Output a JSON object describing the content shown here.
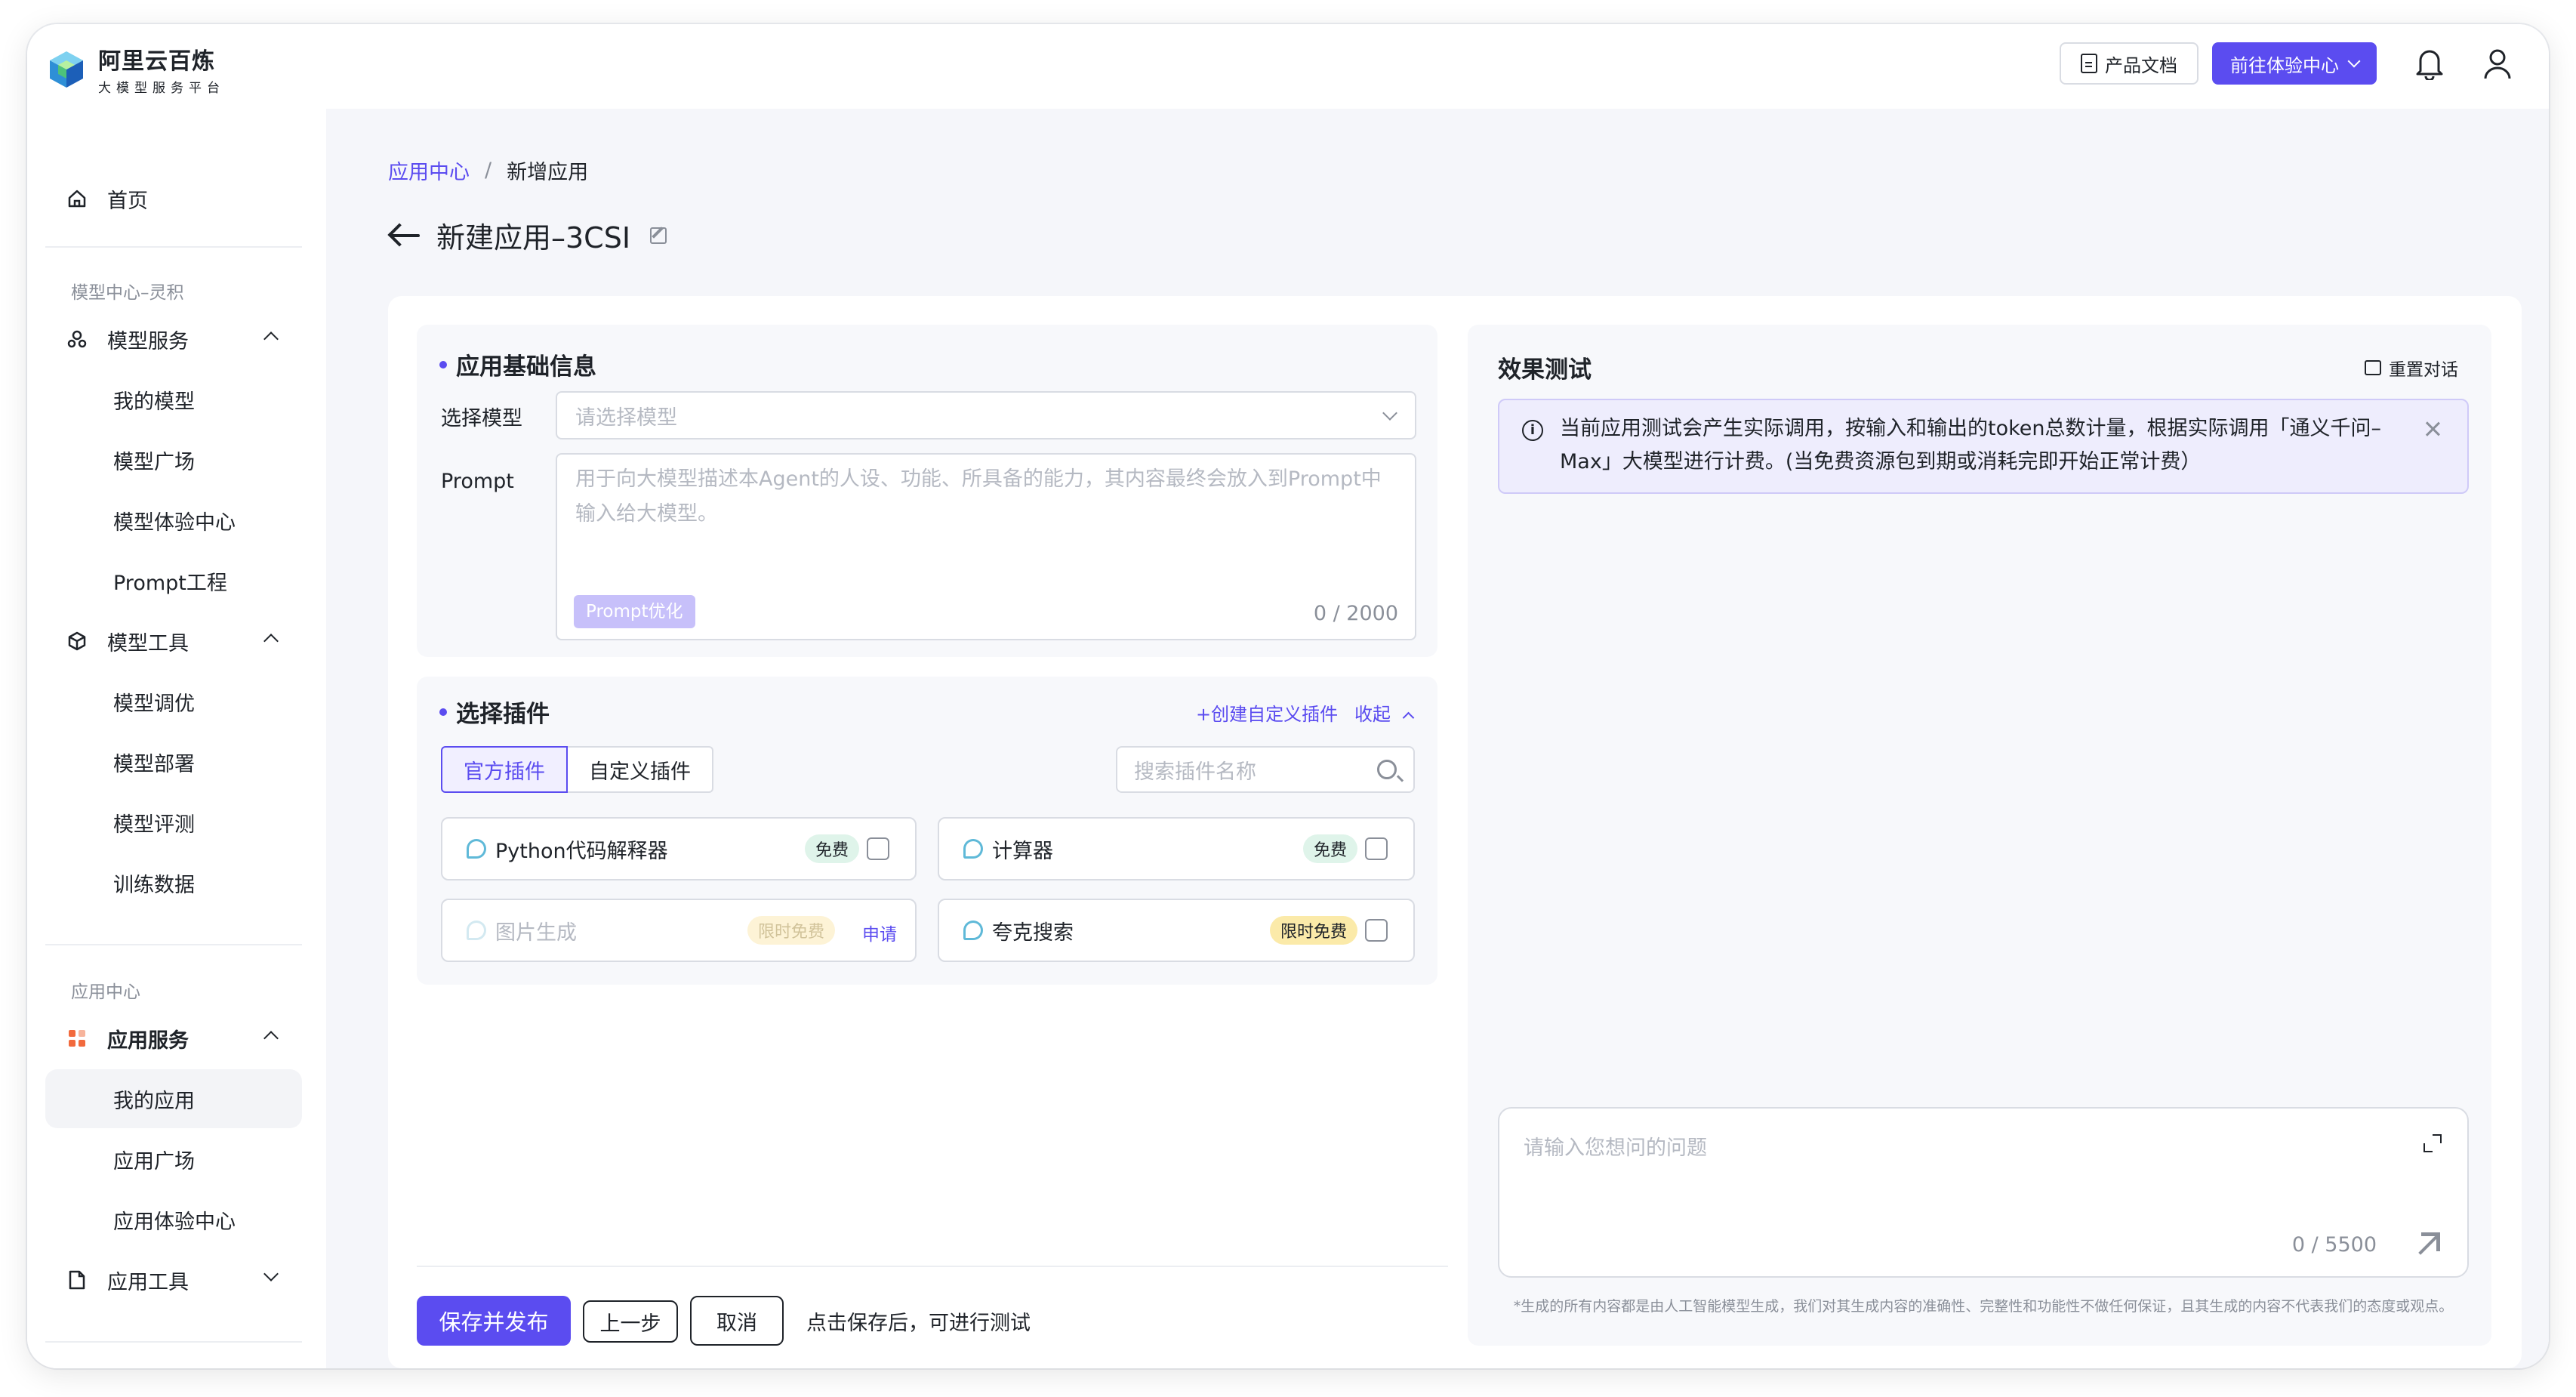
{
  "brand": {
    "name": "阿里云百炼",
    "tagline": "大模型服务平台"
  },
  "header": {
    "doc_button": "产品文档",
    "go_button": "前往体验中心"
  },
  "sidebar": {
    "home": "首页",
    "group1": "模型中心–灵积",
    "model_service": "模型服务",
    "model_service_items": [
      "我的模型",
      "模型广场",
      "模型体验中心",
      "Prompt工程"
    ],
    "model_tools": "模型工具",
    "model_tools_items": [
      "模型调优",
      "模型部署",
      "模型评测",
      "训练数据"
    ],
    "group2": "应用中心",
    "app_service": "应用服务",
    "app_service_items": [
      "我的应用",
      "应用广场",
      "应用体验中心"
    ],
    "app_tools": "应用工具"
  },
  "breadcrumb": {
    "parent": "应用中心",
    "separator": "/",
    "current": "新增应用"
  },
  "page_title": "新建应用–3CSI",
  "basic": {
    "title": "应用基础信息",
    "model_label": "选择模型",
    "model_placeholder": "请选择模型",
    "prompt_label": "Prompt",
    "prompt_placeholder": "用于向大模型描述本Agent的人设、功能、所具备的能力，其内容最终会放入到Prompt中输入给大模型。",
    "prompt_optimize": "Prompt优化",
    "prompt_counter": "0 / 2000"
  },
  "plugins": {
    "title": "选择插件",
    "create_link": "+创建自定义插件",
    "collapse_link": "收起",
    "tab_official": "官方插件",
    "tab_custom": "自定义插件",
    "search_placeholder": "搜索插件名称",
    "items": [
      {
        "name": "Python代码解释器",
        "badge": "免费"
      },
      {
        "name": "计算器",
        "badge": "免费"
      },
      {
        "name": "图片生成",
        "badge": "限时免费",
        "action": "申请"
      },
      {
        "name": "夸克搜索",
        "badge": "限时免费"
      }
    ]
  },
  "footer": {
    "save": "保存并发布",
    "prev": "上一步",
    "cancel": "取消",
    "hint": "点击保存后，可进行测试"
  },
  "test": {
    "title": "效果测试",
    "reset": "重置对话",
    "notice": "当前应用测试会产生实际调用，按输入和输出的token总数计量，根据实际调用「通义千问–Max」大模型进行计费。(当免费资源包到期或消耗完即开始正常计费）",
    "input_placeholder": "请输入您想问的问题",
    "input_counter": "0 / 5500",
    "disclaimer": "*生成的所有内容都是由人工智能模型生成，我们对其生成内容的准确性、完整性和功能性不做任何保证，且其生成的内容不代表我们的态度或观点。"
  },
  "colors": {
    "primary": "#5b4cf0",
    "free_badge": "#dff4ea",
    "limited_badge": "#fbeaa9"
  }
}
